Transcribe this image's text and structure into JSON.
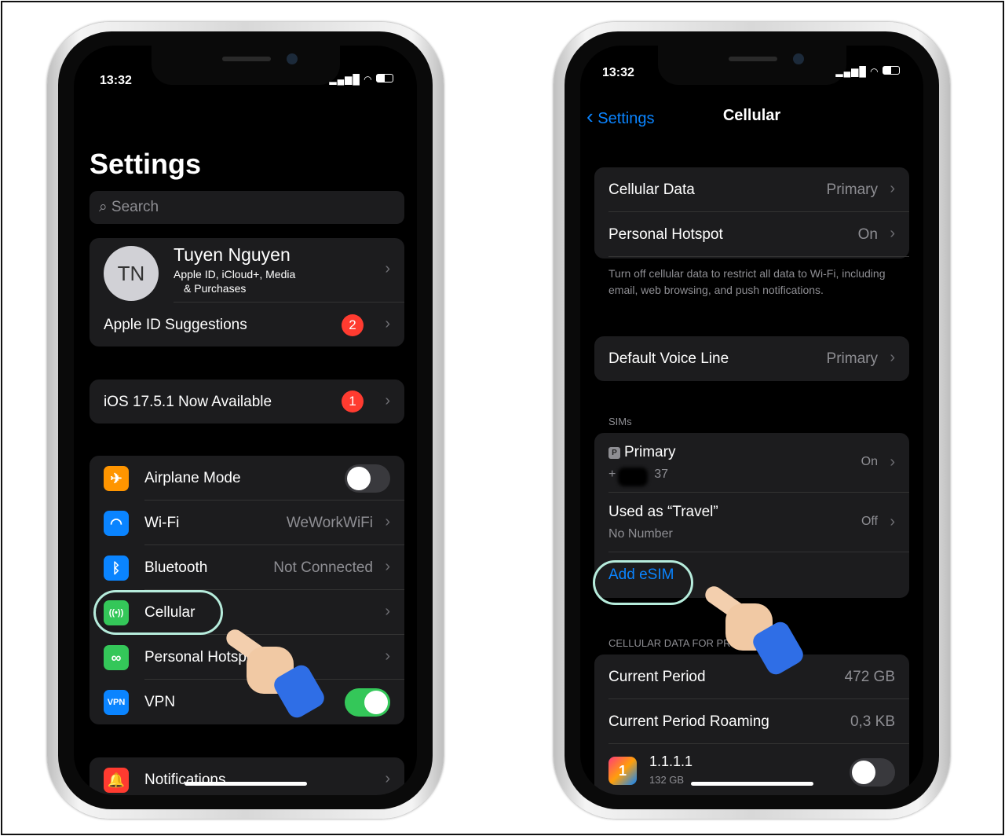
{
  "left": {
    "status": {
      "time": "13:32",
      "signal": "▂▄▆█",
      "wifi": "wifi",
      "battery": "battery"
    },
    "title": "Settings",
    "search": {
      "placeholder": "Search",
      "icon": "magnifier"
    },
    "profile": {
      "initials": "TN",
      "name": "Tuyen Nguyen",
      "subtitle1": "Apple ID, iCloud+, Media",
      "subtitle2": "& Purchases"
    },
    "suggestions": {
      "label": "Apple ID Suggestions",
      "badge": "2"
    },
    "update": {
      "label": "iOS 17.5.1 Now Available",
      "badge": "1"
    },
    "items": [
      {
        "label": "Airplane Mode",
        "icon": "airplane",
        "color": "#ff9500",
        "toggle": false
      },
      {
        "label": "Wi-Fi",
        "icon": "wifi",
        "color": "#0a84ff",
        "value": "WeWorkWiFi"
      },
      {
        "label": "Bluetooth",
        "icon": "bluetooth",
        "color": "#0a84ff",
        "value": "Not Connected"
      },
      {
        "label": "Cellular",
        "icon": "antenna",
        "color": "#34c759"
      },
      {
        "label": "Personal Hotspot",
        "icon": "link",
        "color": "#34c759"
      },
      {
        "label": "VPN",
        "icon": "VPN",
        "color": "#0a84ff",
        "toggle": true
      }
    ],
    "notifications": {
      "label": "Notifications",
      "icon": "bell",
      "color": "#ff3b30"
    }
  },
  "right": {
    "status": {
      "time": "13:32",
      "signal": "▂▄▆█"
    },
    "nav": {
      "back": "Settings",
      "title": "Cellular"
    },
    "group1": [
      {
        "label": "Cellular Data",
        "value": "Primary"
      },
      {
        "label": "Personal Hotspot",
        "value": "On"
      }
    ],
    "footer1": "Turn off cellular data to restrict all data to Wi-Fi, including email, web browsing, and push notifications.",
    "voice": {
      "label": "Default Voice Line",
      "value": "Primary"
    },
    "sims_header": "SIMs",
    "sims": [
      {
        "tag": "P",
        "label": "Primary",
        "sub": "+           37",
        "value": "On"
      },
      {
        "label": "Used as “Travel”",
        "sub": "No Number",
        "value": "Off"
      }
    ],
    "add_esim": "Add eSIM",
    "data_header": "CELLULAR DATA FOR PRIMARY",
    "usage": [
      {
        "label": "Current Period",
        "value": "472 GB"
      },
      {
        "label": "Current Period Roaming",
        "value": "0,3 KB"
      }
    ],
    "app": {
      "name": "1.1.1.1",
      "size": "132 GB",
      "toggle": false
    }
  }
}
